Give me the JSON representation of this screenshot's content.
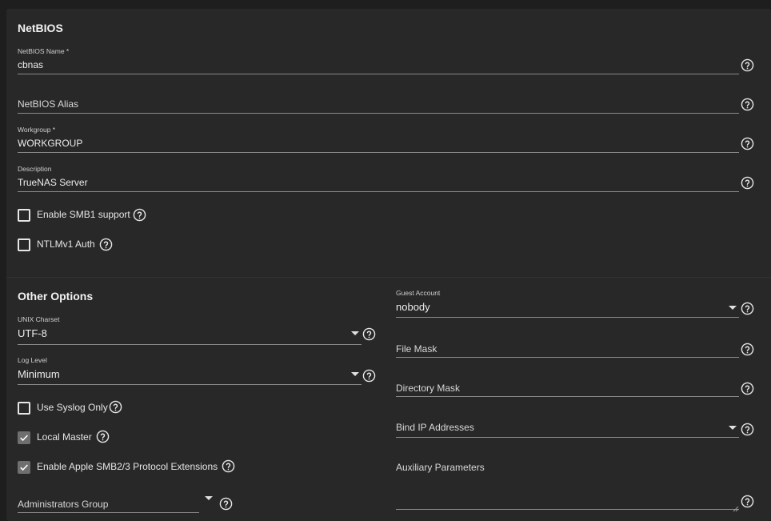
{
  "netbios": {
    "heading": "NetBIOS",
    "name": {
      "label": "NetBIOS Name *",
      "value": "cbnas"
    },
    "alias": {
      "placeholder": "NetBIOS Alias"
    },
    "workgroup": {
      "label": "Workgroup *",
      "value": "WORKGROUP"
    },
    "description": {
      "label": "Description",
      "value": "TrueNAS Server"
    },
    "smb1": {
      "label": "Enable SMB1 support",
      "checked": false
    },
    "ntlmv1": {
      "label": "NTLMv1 Auth",
      "checked": false
    }
  },
  "other": {
    "heading": "Other Options",
    "unix_charset": {
      "label": "UNIX Charset",
      "value": "UTF-8"
    },
    "log_level": {
      "label": "Log Level",
      "value": "Minimum"
    },
    "syslog_only": {
      "label": "Use Syslog Only",
      "checked": false
    },
    "local_master": {
      "label": "Local Master",
      "checked": true
    },
    "apple_ext": {
      "label": "Enable Apple SMB2/3 Protocol Extensions",
      "checked": true
    },
    "admin_group": {
      "placeholder": "Administrators Group"
    },
    "guest_account": {
      "label": "Guest Account",
      "value": "nobody"
    },
    "file_mask": {
      "placeholder": "File Mask"
    },
    "directory_mask": {
      "placeholder": "Directory Mask"
    },
    "bind_ip": {
      "placeholder": "Bind IP Addresses"
    },
    "aux_params": {
      "placeholder": "Auxiliary Parameters"
    }
  },
  "icons": {
    "help": "help-circle-icon",
    "dropdown": "caret-down-icon",
    "check": "check-icon"
  },
  "colors": {
    "background": "#1e1e1e",
    "card": "#282828",
    "underline": "#8a8a8a",
    "checked_box": "#6f6f6f"
  }
}
